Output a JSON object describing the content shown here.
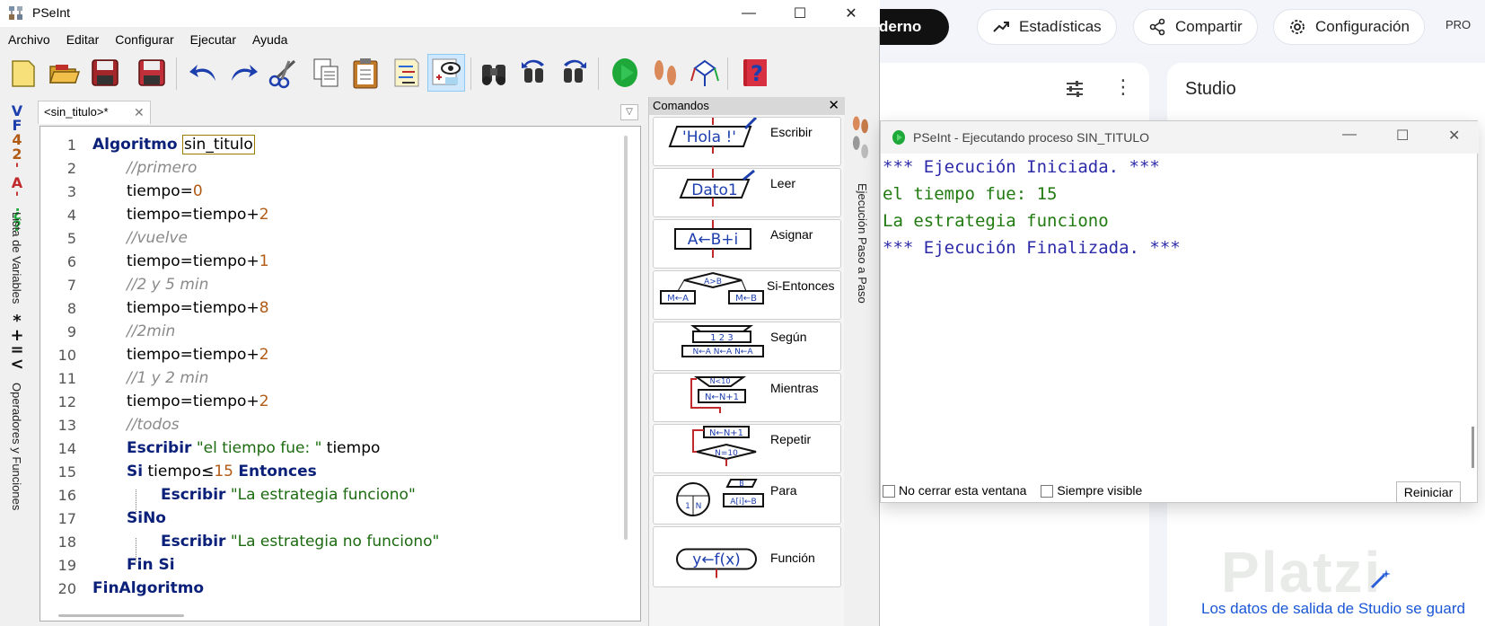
{
  "web": {
    "notebook_btn": "derno",
    "stats_btn": "Estadísticas",
    "share_btn": "Compartir",
    "config_btn": "Configuración",
    "pro_badge": "PRO",
    "studio_title": "Studio",
    "footer_text": "Los datos de salida de Studio se guard",
    "watermark": "Platzi"
  },
  "pseint": {
    "title": "PSeInt",
    "menu": [
      "Archivo",
      "Editar",
      "Configurar",
      "Ejecutar",
      "Ayuda"
    ],
    "tab_label": "<sin_titulo>*",
    "left_labels": {
      "variables": "Lista de Variables",
      "operators": "Operadores y Funciones",
      "var_glyphs": "VF 42 'A' ¿?",
      "op_glyphs": "*+=<"
    },
    "right_label": "Ejecución Paso a Paso",
    "commands_header": "Comandos",
    "commands": [
      {
        "label": "Escribir",
        "shape": "'Hola !'"
      },
      {
        "label": "Leer",
        "shape": "Dato1"
      },
      {
        "label": "Asignar",
        "shape": "A←B+i"
      },
      {
        "label": "Si-Entonces",
        "shape": "A>B"
      },
      {
        "label": "Según",
        "shape": "1 2 3"
      },
      {
        "label": "Mientras",
        "shape": "N<10"
      },
      {
        "label": "Repetir",
        "shape": "N=10"
      },
      {
        "label": "Para",
        "shape": "A[i]←B"
      },
      {
        "label": "Función",
        "shape": "y←f(x)"
      }
    ],
    "code": [
      {
        "n": "1",
        "text": "Algoritmo sin_titulo"
      },
      {
        "n": "2",
        "text": "//primero"
      },
      {
        "n": "3",
        "text": "tiempo=0"
      },
      {
        "n": "4",
        "text": "tiempo=tiempo+2"
      },
      {
        "n": "5",
        "text": "//vuelve"
      },
      {
        "n": "6",
        "text": "tiempo=tiempo+1"
      },
      {
        "n": "7",
        "text": "//2 y 5 min"
      },
      {
        "n": "8",
        "text": "tiempo=tiempo+8"
      },
      {
        "n": "9",
        "text": "//2min"
      },
      {
        "n": "10",
        "text": "tiempo=tiempo+2"
      },
      {
        "n": "11",
        "text": "//1 y 2 min"
      },
      {
        "n": "12",
        "text": "tiempo=tiempo+2"
      },
      {
        "n": "13",
        "text": "//todos"
      },
      {
        "n": "14",
        "text": "Escribir \"el tiempo fue: \" tiempo"
      },
      {
        "n": "15",
        "text": "Si tiempo≤15 Entonces"
      },
      {
        "n": "16",
        "text": "Escribir \"La estrategia funciono\""
      },
      {
        "n": "17",
        "text": "SiNo"
      },
      {
        "n": "18",
        "text": "Escribir \"La estrategia no funciono\""
      },
      {
        "n": "19",
        "text": "Fin Si"
      },
      {
        "n": "20",
        "text": "FinAlgoritmo"
      }
    ]
  },
  "exec": {
    "title": "PSeInt - Ejecutando proceso SIN_TITULO",
    "output": [
      {
        "text": "*** Ejecución Iniciada. ***",
        "kind": "sys"
      },
      {
        "text": "el tiempo fue: 15",
        "kind": "usr"
      },
      {
        "text": "La estrategia funciono",
        "kind": "usr"
      },
      {
        "text": "*** Ejecución Finalizada. ***",
        "kind": "sys"
      }
    ],
    "no_close_label": "No cerrar esta ventana",
    "always_visible_label": "Siempre visible",
    "restart_btn": "Reiniciar"
  }
}
